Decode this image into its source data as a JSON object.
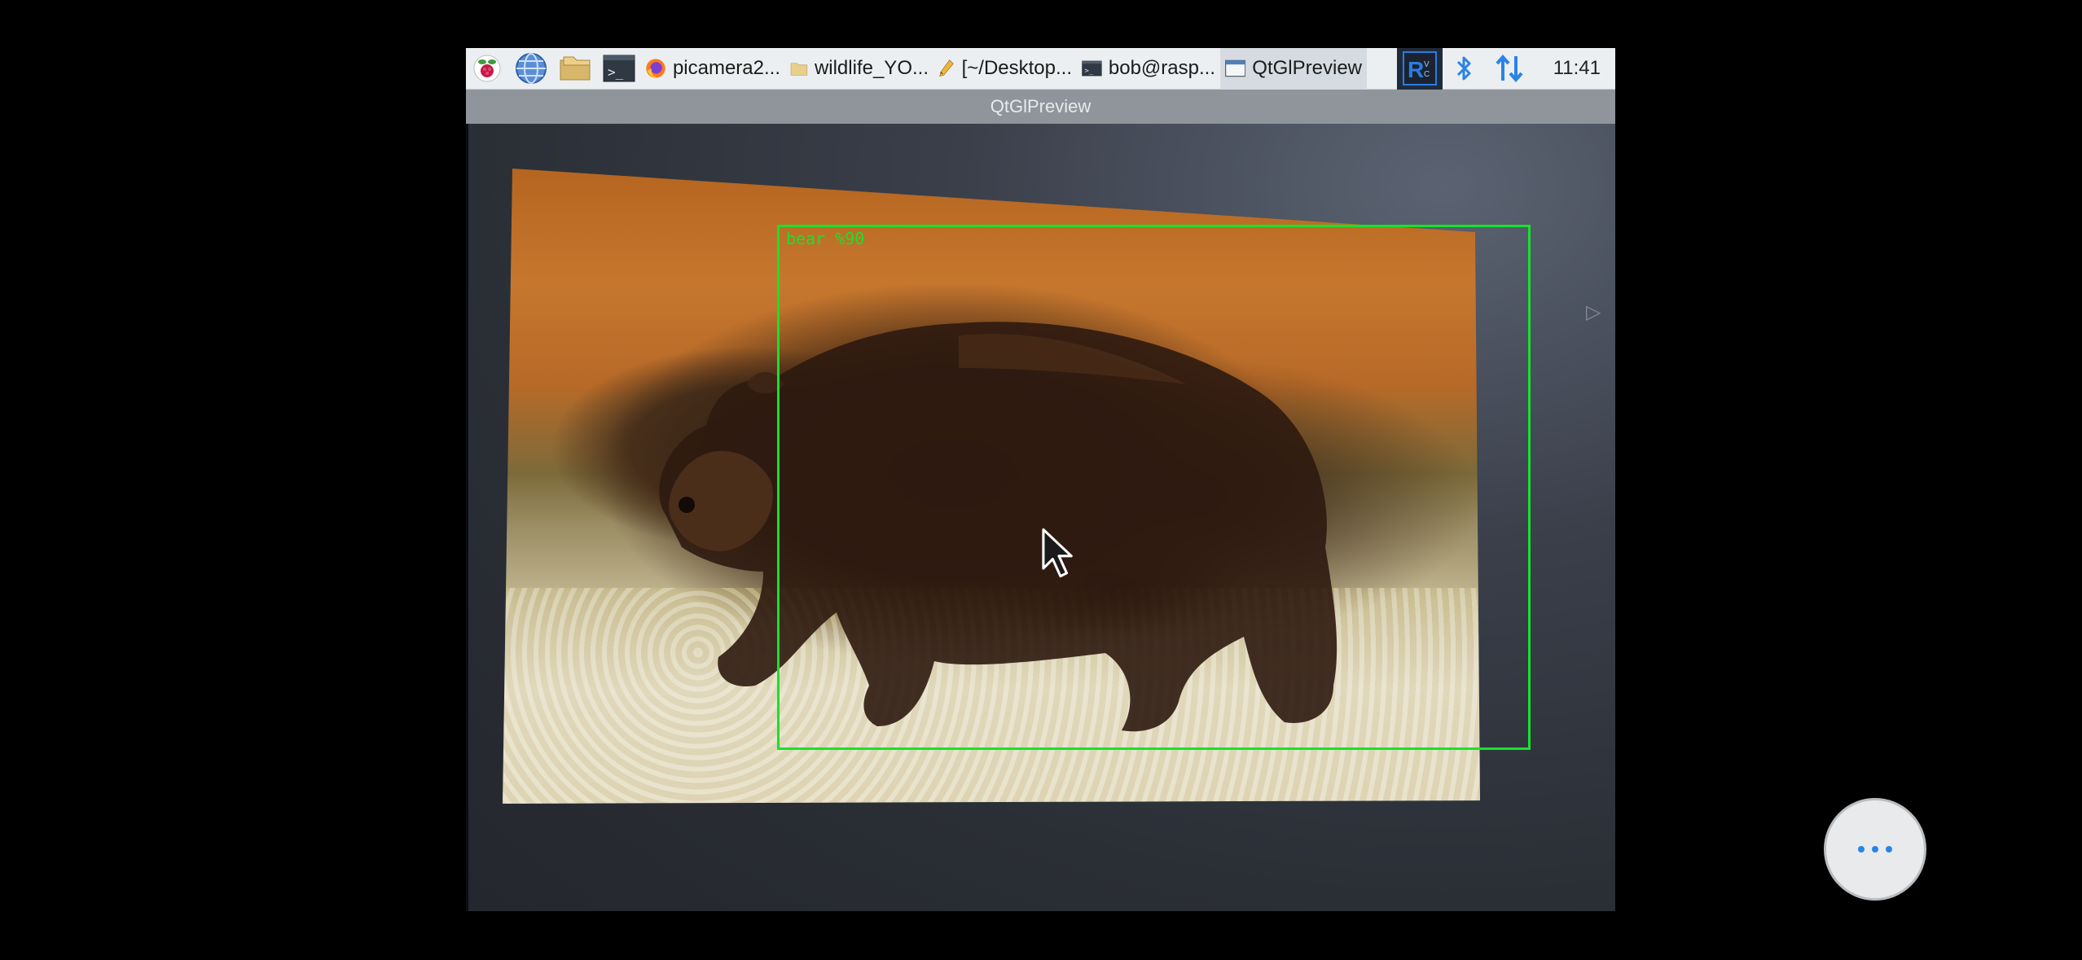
{
  "taskbar": {
    "tasks": [
      {
        "label": "picamera2..."
      },
      {
        "label": "wildlife_YO..."
      },
      {
        "label": "[~/Desktop..."
      },
      {
        "label": "bob@rasp..."
      },
      {
        "label": "QtGlPreview"
      }
    ],
    "clock": "11:41"
  },
  "window": {
    "title": "QtGlPreview"
  },
  "detection": {
    "label": "bear %90",
    "box_color": "#17e22b"
  },
  "colors": {
    "taskbar_bg": "#eceff1",
    "titlebar_bg": "#8f959a",
    "accent": "#2a83e6"
  }
}
